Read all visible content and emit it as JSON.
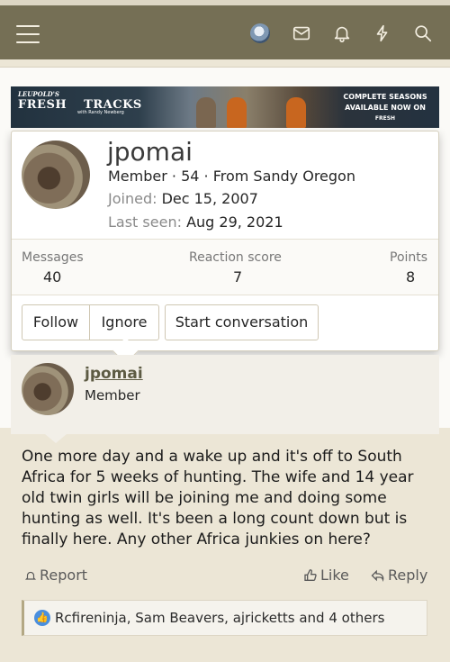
{
  "banner": {
    "brand": "LEUPOLD'S",
    "title_left": "FRESH",
    "title_right": "TRACKS",
    "subtitle": "with Randy Newberg",
    "cta_line1": "COMPLETE SEASONS",
    "cta_line2": "AVAILABLE NOW ON",
    "cta_line3": "FRESH"
  },
  "profile_card": {
    "username": "jpomai",
    "meta": "Member · 54 · From Sandy Oregon",
    "joined_label": "Joined:",
    "joined_value": "Dec 15, 2007",
    "seen_label": "Last seen:",
    "seen_value": "Aug 29, 2021",
    "stats": [
      {
        "label": "Messages",
        "value": "40"
      },
      {
        "label": "Reaction score",
        "value": "7"
      },
      {
        "label": "Points",
        "value": "8"
      }
    ],
    "buttons": {
      "follow": "Follow",
      "ignore": "Ignore",
      "start": "Start conversation"
    }
  },
  "post": {
    "username": "jpomai",
    "role": "Member",
    "body": "One more day and a wake up and it's off to South Africa for 5 weeks of hunting. The wife and 14 year old twin girls will be joining me and doing some hunting as well. It's been a long count down but is finally here. Any other Africa junkies on here?",
    "actions": {
      "report": "Report",
      "like": "Like",
      "reply": "Reply"
    },
    "reactions": "Rcfireninja, Sam Beavers, ajricketts and 4 others"
  },
  "colors": {
    "nav": "#756f55",
    "accent": "#5d5b43",
    "like": "#4a8fde"
  }
}
